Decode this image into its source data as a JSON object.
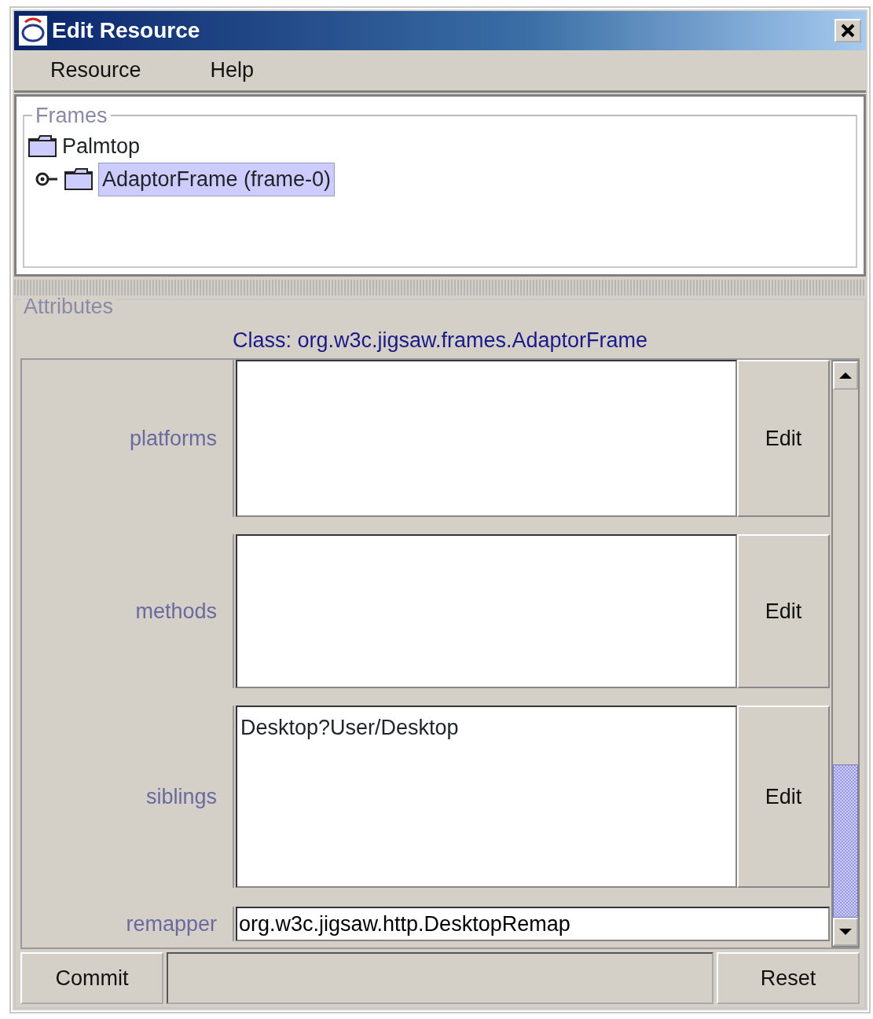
{
  "window": {
    "title": "Edit Resource"
  },
  "menu": [
    {
      "label": "Resource"
    },
    {
      "label": "Help"
    }
  ],
  "frames": {
    "title": "Frames",
    "tree": [
      {
        "label": "Palmtop",
        "selected": false,
        "children": [
          {
            "label": "AdaptorFrame (frame-0)",
            "selected": true
          }
        ]
      }
    ]
  },
  "attributes": {
    "title": "Attributes",
    "class_label": "Class: org.w3c.jigsaw.frames.AdaptorFrame",
    "rows": [
      {
        "kind": "list",
        "label": "platforms",
        "value": "",
        "button": "Edit"
      },
      {
        "kind": "list",
        "label": "methods",
        "value": "",
        "button": "Edit"
      },
      {
        "kind": "list",
        "label": "siblings",
        "value": "Desktop?User/Desktop",
        "button": "Edit"
      },
      {
        "kind": "text",
        "label": "remapper",
        "value": "org.w3c.jigsaw.http.DesktopRemap"
      }
    ]
  },
  "buttons": [
    {
      "label": "Commit"
    },
    {
      "label": "Reset"
    }
  ]
}
